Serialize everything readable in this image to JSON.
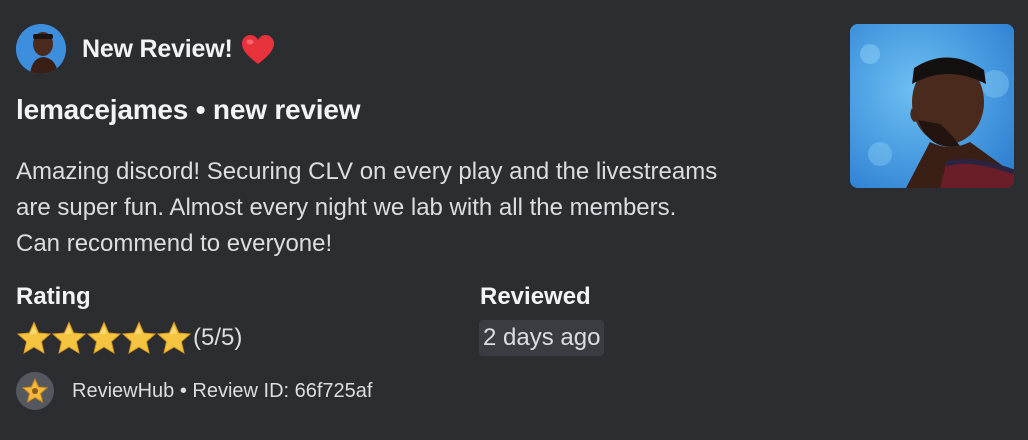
{
  "author": {
    "name": "New Review!",
    "emoji_icon": "heart-icon",
    "avatar_icon": "avatar-photo"
  },
  "title": "lemacejames • new review",
  "description": {
    "lines": [
      "Amazing discord! Securing CLV on every play and the livestreams",
      "are super fun. Almost every night we lab with all the members.",
      "Can recommend to everyone!"
    ]
  },
  "fields": {
    "rating": {
      "name": "Rating",
      "stars_filled": 5,
      "stars_total": 5,
      "value_text": "(5/5)"
    },
    "reviewed": {
      "name": "Reviewed",
      "value": "2 days ago"
    }
  },
  "footer": {
    "icon": "star-badge-icon",
    "text": "ReviewHub • Review ID: 66f725af"
  },
  "thumbnail": {
    "icon": "thumbnail-photo"
  },
  "colors": {
    "background": "#2b2d31",
    "heading": "#f2f3f5",
    "text": "#dbdee1",
    "star": "#f5c542",
    "heart": "#e8323c",
    "pill": "#3a3c42"
  }
}
